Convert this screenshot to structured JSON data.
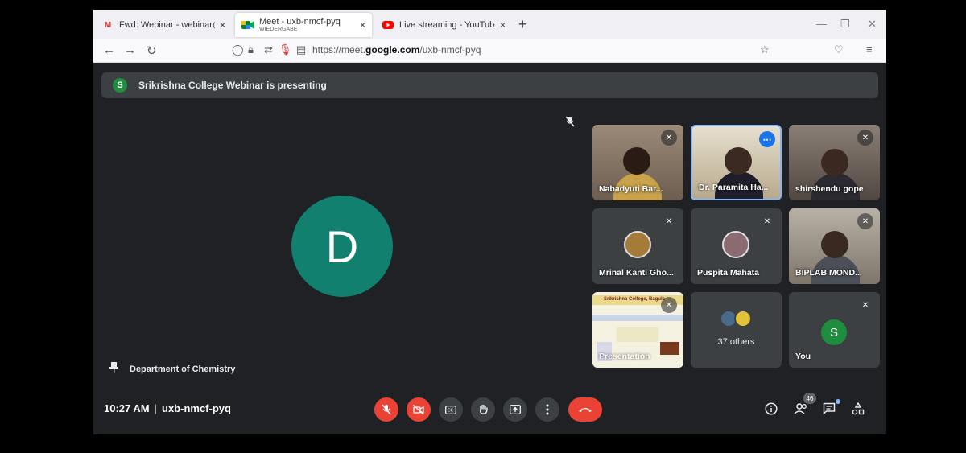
{
  "browser": {
    "tabs": [
      {
        "icon": "gmail-icon",
        "title": "Fwd: Webinar - webinar@srikris",
        "close": "×"
      },
      {
        "icon": "meet-icon",
        "title": "Meet - uxb-nmcf-pyq",
        "subtitle": "WIEDERGABE",
        "close": "×"
      },
      {
        "icon": "youtube-icon",
        "title": "Live streaming - YouTube Studi",
        "close": "×"
      }
    ],
    "new_tab": "+",
    "url_prefix": "https://meet.",
    "url_domain": "google.com",
    "url_path": "/uxb-nmcf-pyq"
  },
  "banner": {
    "avatar_letter": "S",
    "text": "Srikrishna College Webinar is presenting"
  },
  "main_tile": {
    "avatar_letter": "D",
    "pinned_label": "Department of Chemistry"
  },
  "participants": [
    {
      "name": "Nabadyuti Bar...",
      "muted": true
    },
    {
      "name": "Dr. Paramita Ha...",
      "muted": false
    },
    {
      "name": "shirshendu gope",
      "muted": true
    },
    {
      "name": "Mrinal Kanti Gho...",
      "muted": true
    },
    {
      "name": "Puspita Mahata",
      "muted": true
    },
    {
      "name": "BIPLAB MOND...",
      "muted": true
    },
    {
      "name": "Presentation",
      "muted": true
    },
    {
      "name": "37 others"
    },
    {
      "name": "You",
      "avatar_letter": "S",
      "muted": true
    }
  ],
  "slide": {
    "title": "Srikrishna College, Bagula"
  },
  "bottom_bar": {
    "time": "10:27 AM",
    "separator": "|",
    "meeting_code": "uxb-nmcf-pyq",
    "people_count": "46"
  },
  "colors": {
    "meet_bg": "#202124",
    "tile_bg": "#3c4043",
    "danger": "#ea4335",
    "avatar_teal": "#12806f",
    "avatar_green": "#1e8e3e"
  }
}
